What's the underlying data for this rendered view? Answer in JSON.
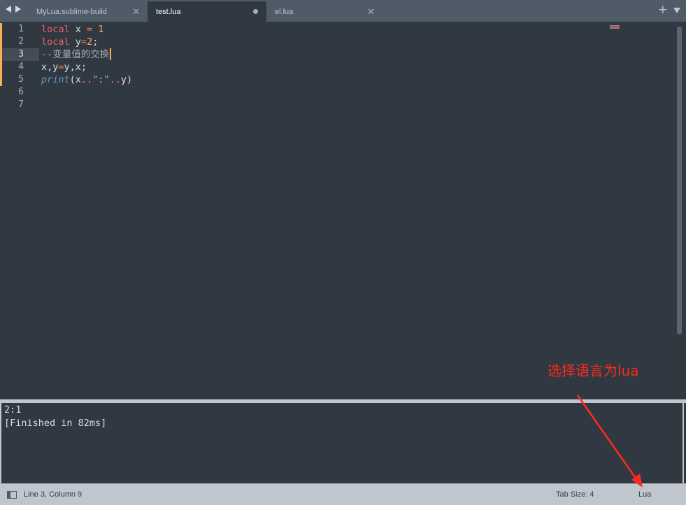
{
  "tabs": [
    {
      "label": "MyLua.sublime-build",
      "active": false,
      "dirty": false
    },
    {
      "label": "test.lua",
      "active": true,
      "dirty": true
    },
    {
      "label": "el.lua",
      "active": false,
      "dirty": false
    }
  ],
  "tab_controls": {
    "add": "+"
  },
  "editor": {
    "line_numbers": [
      "1",
      "2",
      "3",
      "4",
      "5",
      "6",
      "7"
    ],
    "lines": {
      "l1": {
        "kw": "local",
        "var": " x ",
        "op": "=",
        "num": " 1"
      },
      "l2": {
        "kw": "local",
        "var": " y",
        "op": "=",
        "num": "2",
        "end": ";"
      },
      "l3": {
        "comment": "--变量值的交换"
      },
      "l4": {
        "a": "x,y",
        "op": "=",
        "b": "y,x;"
      },
      "l5": {
        "fn": "print",
        "p1": "(x",
        "cat1": "..",
        "str": "\":\"",
        "cat2": "..",
        "p2": "y)"
      }
    },
    "current_line": 3
  },
  "output": {
    "lines": [
      "2:1",
      "[Finished in 82ms]"
    ]
  },
  "status": {
    "position": "Line 3, Column 9",
    "tab_size": "Tab Size: 4",
    "syntax": "Lua"
  },
  "annotation": {
    "text": "选择语言为lua",
    "color": "#ff2a1a"
  },
  "colors": {
    "background": "#303841",
    "tabbar": "#4f5b66",
    "statusbar": "#c0c5ce",
    "keyword": "#ec5f66",
    "number": "#f9ae58",
    "string": "#99c794",
    "function": "#6699cc"
  },
  "icons": {
    "back": "nav-back-icon",
    "forward": "nav-forward-icon",
    "close": "close-icon",
    "dirty": "unsaved-dot-icon",
    "menu": "chevron-down-icon",
    "panel": "panel-toggle-icon"
  }
}
